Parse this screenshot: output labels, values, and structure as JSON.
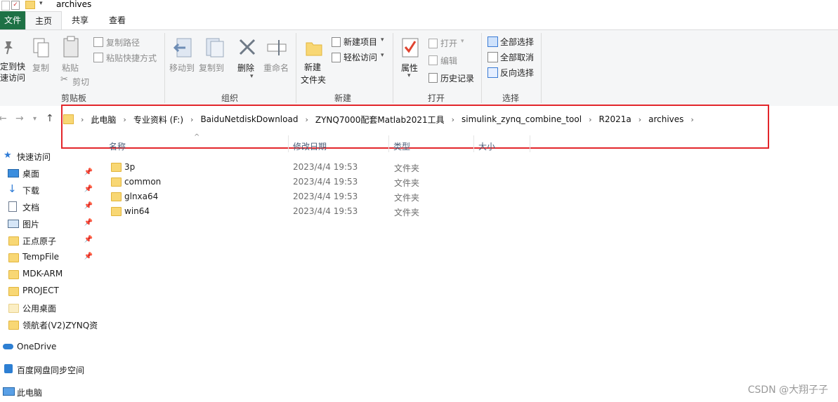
{
  "window": {
    "title": "archives"
  },
  "tabs": [
    {
      "label": "文件"
    },
    {
      "label": "主页"
    },
    {
      "label": "共享"
    },
    {
      "label": "查看"
    }
  ],
  "ribbon": {
    "clipboard": {
      "pin": "定到快\n速访问",
      "copy": "复制",
      "paste": "粘贴",
      "copy_path": "复制路径",
      "paste_shortcut": "粘贴快捷方式",
      "cut": "剪切",
      "label": "剪贴板"
    },
    "organize": {
      "move_to": "移动到",
      "copy_to": "复制到",
      "delete": "删除",
      "rename": "重命名",
      "label": "组织"
    },
    "new": {
      "new_folder_1": "新建",
      "new_folder_2": "文件夹",
      "new_item": "新建项目",
      "easy_access": "轻松访问",
      "label": "新建"
    },
    "open": {
      "properties": "属性",
      "open": "打开",
      "edit": "编辑",
      "history": "历史记录",
      "label": "打开"
    },
    "select": {
      "select_all": "全部选择",
      "select_none": "全部取消",
      "invert": "反向选择",
      "label": "选择"
    }
  },
  "breadcrumb": [
    "此电脑",
    "专业资料 (F:)",
    "BaiduNetdiskDownload",
    "ZYNQ7000配套Matlab2021工具",
    "simulink_zynq_combine_tool",
    "R2021a",
    "archives"
  ],
  "columns": {
    "name": "名称",
    "date": "修改日期",
    "type": "类型",
    "size": "大小"
  },
  "nav_pane": {
    "quick_access": "快速访问",
    "items": [
      "桌面",
      "下载",
      "文档",
      "图片",
      "正点原子",
      "TempFile",
      "MDK-ARM",
      "PROJECT",
      "公用桌面",
      "领航者(V2)ZYNQ资"
    ],
    "onedrive": "OneDrive",
    "baidu": "百度网盘同步空间",
    "this_pc": "此电脑"
  },
  "files": [
    {
      "name": "3p",
      "date": "2023/4/4 19:53",
      "type": "文件夹"
    },
    {
      "name": "common",
      "date": "2023/4/4 19:53",
      "type": "文件夹"
    },
    {
      "name": "glnxa64",
      "date": "2023/4/4 19:53",
      "type": "文件夹"
    },
    {
      "name": "win64",
      "date": "2023/4/4 19:53",
      "type": "文件夹"
    }
  ],
  "watermark": "CSDN @大翔子子",
  "colors": {
    "file_tab": "#1e7145",
    "highlight_box": "#e3262b",
    "folder": "#f8d774"
  }
}
